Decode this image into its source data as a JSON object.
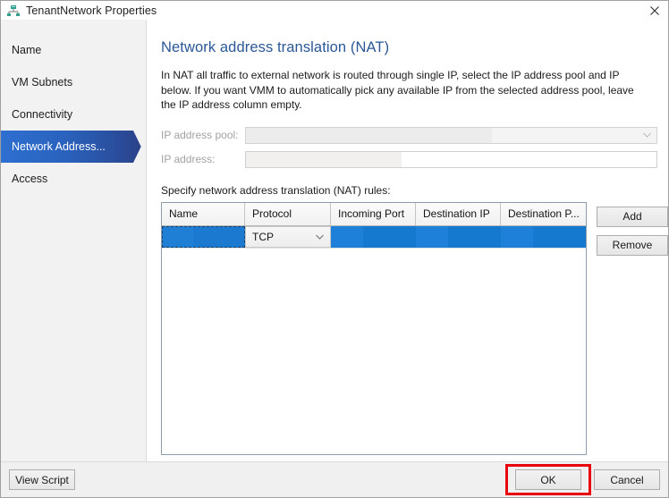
{
  "window": {
    "title": "TenantNetwork Properties",
    "icon": "network-properties-icon",
    "close_label": "✕"
  },
  "sidebar": {
    "items": [
      {
        "label": "Name",
        "selected": false
      },
      {
        "label": "VM Subnets",
        "selected": false
      },
      {
        "label": "Connectivity",
        "selected": false
      },
      {
        "label": "Network Address...",
        "selected": true
      },
      {
        "label": "Access",
        "selected": false
      }
    ]
  },
  "main": {
    "heading": "Network address translation (NAT)",
    "intro": "In NAT all traffic to external network is routed through single IP, select the IP address pool and IP below. If you want VMM to automatically pick any available IP from the selected address pool, leave the IP address column empty.",
    "fields": {
      "pool_label": "IP address pool:",
      "pool_value": "",
      "pool_placeholder": "",
      "ip_label": "IP address:",
      "ip_value": "",
      "ip_placeholder": ""
    },
    "rules_label": "Specify network address translation (NAT) rules:",
    "grid": {
      "columns": [
        "Name",
        "Protocol",
        "Incoming Port",
        "Destination IP",
        "Destination P..."
      ],
      "rows": [
        {
          "name": "",
          "protocol": "TCP",
          "incoming_port": "",
          "destination_ip": "",
          "destination_port": "",
          "selected": true
        }
      ]
    },
    "buttons": {
      "add": "Add",
      "remove": "Remove"
    }
  },
  "footer": {
    "view_script": "View Script",
    "ok": "OK",
    "cancel": "Cancel"
  },
  "colors": {
    "accent_blue": "#2b5797",
    "selection_blue": "#1479cf",
    "nav_selected_start": "#2e6fd0",
    "nav_selected_end": "#2c3f86",
    "highlight_red": "#e8000d"
  }
}
